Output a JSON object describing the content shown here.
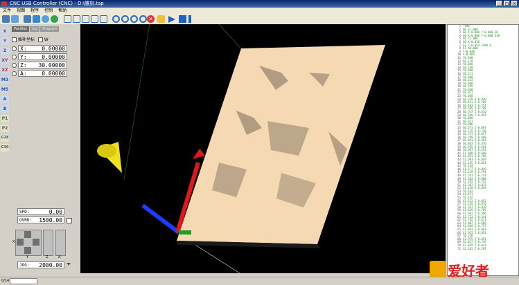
{
  "window": {
    "title": "CNC USB Controller (CNC) - D:\\雕刻.tap"
  },
  "menu": [
    "文件",
    "视图",
    "程序",
    "控制",
    "帮助"
  ],
  "left": {
    "tabs": [
      "Position",
      "Jog",
      "Program"
    ],
    "mode": {
      "label": "插补坐标",
      "check_label": "W"
    },
    "coords": [
      {
        "axis": "X:",
        "value": "0.00000"
      },
      {
        "axis": "Y:",
        "value": "0.00000"
      },
      {
        "axis": "Z:",
        "value": "30.00000"
      },
      {
        "axis": "A:",
        "value": "0.00000"
      }
    ],
    "side_icons": [
      "X",
      "Y",
      "Z",
      "XY",
      "XZ",
      "M3",
      "M5",
      "A",
      "B",
      "P1",
      "P2",
      "G28",
      "G30"
    ],
    "spd": {
      "label": "SPD:",
      "value": "0.00"
    },
    "ovrd": {
      "label": "OVRD:",
      "value": "1500.00"
    },
    "jog": {
      "label": "JOG:",
      "value": "2000.00"
    },
    "jogpad_labels": [
      "X",
      "Y",
      "Z",
      "A"
    ]
  },
  "gcode": [
    [
      "1",
      "T1M6"
    ],
    [
      "2",
      "G0 Z1.000"
    ],
    [
      "3",
      "G0 X-0.000 Y-0.000 S0"
    ],
    [
      "4",
      "G0 X-0.000 Y-0.000 Z10"
    ],
    [
      "5",
      "G0 Z1.000"
    ],
    [
      "6",
      "G0 X-0.018"
    ],
    [
      "7",
      "G1 Z-0.854 F400.0"
    ],
    [
      "8",
      "G1 X0.000"
    ],
    [
      "9",
      "Y-0.048"
    ],
    [
      "10",
      "X-0.003"
    ],
    [
      "11",
      "Y0.048"
    ],
    [
      "12",
      "X0.119"
    ],
    [
      "13",
      "Y0.048"
    ],
    [
      "14",
      "X0.169"
    ],
    [
      "15",
      "Y0.048"
    ],
    [
      "16",
      "X0.211"
    ],
    [
      "17",
      "Y0.048"
    ],
    [
      "18",
      "X0.253"
    ],
    [
      "19",
      "Y0.048"
    ],
    [
      "20",
      "X0.295"
    ],
    [
      "21",
      "Y0.048"
    ],
    [
      "22",
      "X0.337"
    ],
    [
      "23",
      "Y0.048"
    ],
    [
      "24",
      "X0.379 Z-0.849"
    ],
    [
      "25",
      "X0.421 Z-0.768"
    ],
    [
      "26",
      "X0.463 Z-0.754"
    ],
    [
      "27",
      "X0.505 Z-0.790"
    ],
    [
      "28",
      "X0.547 Z-0.810"
    ],
    [
      "29",
      "X0.589 Z-0.854"
    ],
    [
      "30",
      "Y0.096"
    ],
    [
      "31",
      "X0.631"
    ],
    [
      "32",
      "Y0.096"
    ],
    [
      "33",
      "X0.673 Z-0.867"
    ],
    [
      "34",
      "X0.715 Z-0.749"
    ],
    [
      "35",
      "X0.757 Z-0.657"
    ],
    [
      "36",
      "X0.799 Z-0.498"
    ],
    [
      "37",
      "X0.841 Z-0.481"
    ],
    [
      "38",
      "X0.883 Z-0.470"
    ],
    [
      "39",
      "X0.925 Z-0.501"
    ],
    [
      "40",
      "X0.967 Z-0.593"
    ],
    [
      "41",
      "X1.009 Z-0.680"
    ],
    [
      "42",
      "X1.051 Z-0.766"
    ],
    [
      "43",
      "X1.093 Z-0.849"
    ],
    [
      "44",
      "X1.135 Z-0.854"
    ],
    [
      "45",
      "Y0.144"
    ],
    [
      "46",
      "X1.177 Z-0.849"
    ],
    [
      "47",
      "X1.219 Z-0.794"
    ],
    [
      "48",
      "X1.261 Z-0.754"
    ],
    [
      "49",
      "X1.303 Z-0.688"
    ],
    [
      "50",
      "X1.345 Z-0.742"
    ],
    [
      "51",
      "X1.387 Z-0.813"
    ],
    [
      "52",
      "X1.429 Z-0.854"
    ],
    [
      "53",
      "Y0.192"
    ],
    [
      "54",
      "X1.471"
    ],
    [
      "55",
      "Y0.192"
    ],
    [
      "56",
      "X1.513 Z-0.851"
    ],
    [
      "57",
      "X1.555 Z-0.870"
    ],
    [
      "58",
      "X1.597 Z-0.818"
    ],
    [
      "59",
      "X1.639 Z-0.705"
    ],
    [
      "60",
      "X1.681 Z-0.496"
    ],
    [
      "61",
      "X1.723 Z-0.544"
    ],
    [
      "62",
      "X1.765 Z-0.611"
    ],
    [
      "63",
      "X1.807 Z-0.688"
    ],
    [
      "64",
      "X1.849 Z-0.757"
    ],
    [
      "65",
      "X1.891 Z-0.803"
    ],
    [
      "66",
      "X1.933 Z-0.854"
    ],
    [
      "67",
      "Y0.240"
    ],
    [
      "68",
      "X1.975 Z-0.851"
    ],
    [
      "69",
      "X2.017 Z-0.749"
    ],
    [
      "70",
      "X2.059 Z-0.641"
    ],
    [
      "71",
      "X2.101 Z-0.587"
    ]
  ],
  "status": {
    "text": "0/14"
  },
  "logo_text": "爱好者",
  "colors": {
    "viewport_bg": "#000000",
    "relief": "#f5d9b3",
    "x_axis": "#1a3cff",
    "z_axis": "#e01818",
    "cone": "#f0e020"
  }
}
